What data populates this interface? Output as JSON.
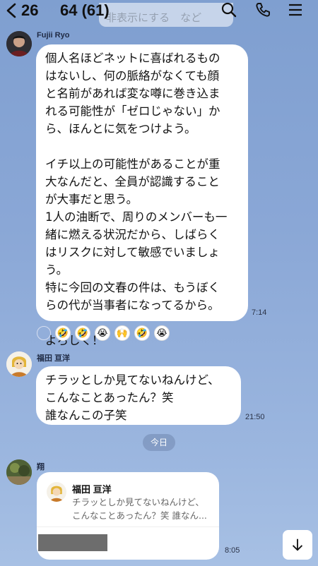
{
  "header": {
    "back_count": "26",
    "title": "64 (61)",
    "ghost_text": "非表示にする　など"
  },
  "messages": [
    {
      "sender": "Fujii Ryo",
      "text": "個人名ほどネットに喜ばれるもの\nはないし、何の脈絡がなくても顔\nと名前があれば変な噂に巻き込ま\nれる可能性が「ゼロじゃない」か\nら、ほんとに気をつけよう。\n\nイチ以上の可能性があることが重\n大なんだと、全員が認識すること\nが大事だと思う。\n1人の油断で、周りのメンバーも一\n緒に燃える状況だから、しばらく\nはリスクに対して敏感でいましょ\nう。\n特に今回の文春の件は、もうぼく\nらの代が当事者になってるから。\n\nよろしく！",
      "time": "7:14",
      "reactions": [
        "🤣",
        "🤣",
        "😭",
        "🙌",
        "🤣",
        "😭"
      ]
    },
    {
      "sender": "福田 亘洋",
      "text": "チラッとしか見てないねんけど、\nこんなことあったん？笑\n誰なんこの子笑",
      "time": "21:50"
    },
    {
      "sender": "翔",
      "reply_name": "福田 亘洋",
      "reply_text": "チラッとしか見てないねんけど、\nこんなことあったん？笑 誰なん...",
      "time": "8:05"
    }
  ],
  "date_separator": "今日",
  "colors": {
    "background": "#8aa7d6",
    "bubble": "#ffffff",
    "date_pill": "#7a8fb5"
  },
  "icons": [
    "chevron-left-icon",
    "search-icon",
    "phone-icon",
    "menu-icon",
    "smiley-add-icon",
    "arrow-down-icon"
  ]
}
